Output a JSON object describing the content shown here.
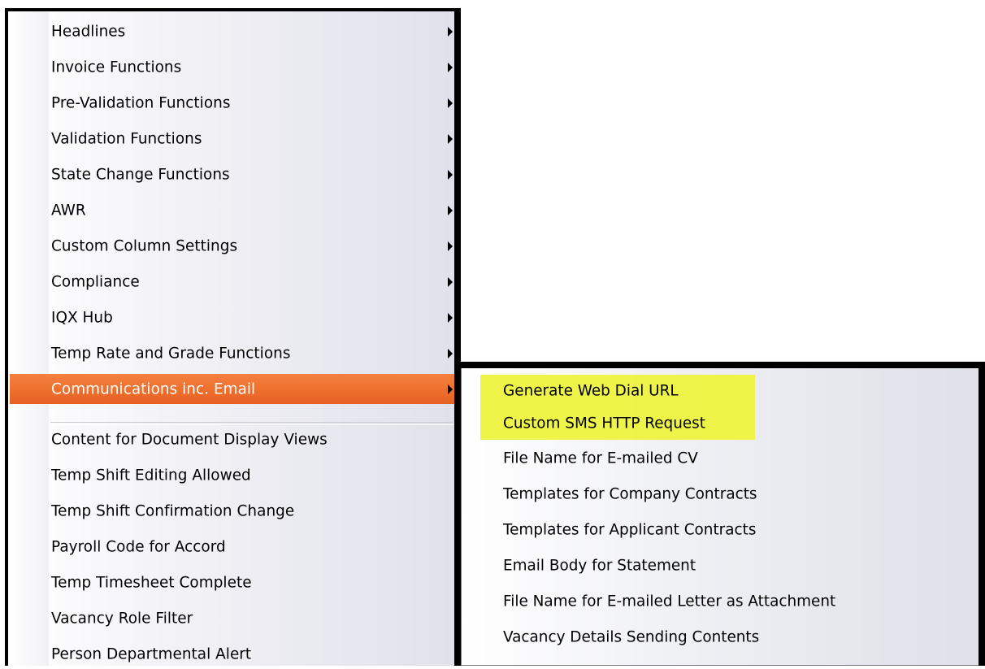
{
  "main_menu": {
    "items": [
      {
        "label": "Headlines",
        "has_submenu": true
      },
      {
        "label": "Invoice Functions",
        "has_submenu": true
      },
      {
        "label": "Pre-Validation Functions",
        "has_submenu": true
      },
      {
        "label": "Validation Functions",
        "has_submenu": true
      },
      {
        "label": "State Change Functions",
        "has_submenu": true
      },
      {
        "label": "AWR",
        "has_submenu": true
      },
      {
        "label": "Custom Column Settings",
        "has_submenu": true
      },
      {
        "label": "Compliance",
        "has_submenu": true
      },
      {
        "label": "IQX Hub",
        "has_submenu": true
      },
      {
        "label": "Temp Rate and Grade Functions",
        "has_submenu": true
      },
      {
        "label": "Communications inc. Email",
        "has_submenu": true,
        "selected": true
      }
    ],
    "items_after_separator": [
      {
        "label": "Content for Document Display Views"
      },
      {
        "label": "Temp Shift Editing Allowed"
      },
      {
        "label": "Temp Shift Confirmation Change"
      },
      {
        "label": "Payroll Code for Accord"
      },
      {
        "label": "Temp Timesheet Complete"
      },
      {
        "label": "Vacancy Role Filter"
      },
      {
        "label": "Person Departmental Alert"
      }
    ]
  },
  "submenu": {
    "parent": "Communications inc. Email",
    "items": [
      {
        "label": "Generate Web Dial URL",
        "highlighted": true
      },
      {
        "label": "Custom SMS HTTP Request",
        "highlighted": true
      },
      {
        "label": "File Name for E-mailed CV"
      },
      {
        "label": "Templates for Company Contracts"
      },
      {
        "label": "Templates for Applicant Contracts"
      },
      {
        "label": "Email Body for Statement"
      },
      {
        "label": "File Name for E-mailed Letter as Attachment"
      },
      {
        "label": "Vacancy Details Sending Contents"
      }
    ]
  },
  "colors": {
    "selected_item": "#ee6f2c",
    "highlight_marker": "#eef33a",
    "border": "#000000"
  },
  "icons": {
    "submenu_arrow": "triangle-right-icon"
  }
}
